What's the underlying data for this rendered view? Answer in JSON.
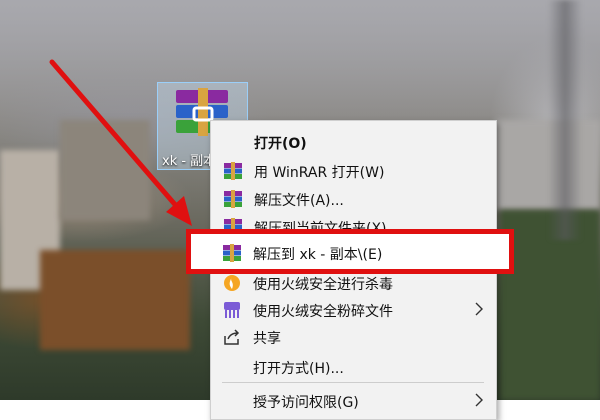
{
  "desktop_icon": {
    "label": "xk - 副本",
    "icon": "winrar-archive-icon"
  },
  "context_menu": {
    "items": [
      {
        "label": "打开(O)",
        "icon": "",
        "bold": true
      },
      {
        "label": "用 WinRAR 打开(W)",
        "icon": "winrar-icon"
      },
      {
        "label": "解压文件(A)...",
        "icon": "winrar-icon"
      },
      {
        "label": "解压到当前文件夹(X)",
        "icon": "winrar-icon"
      },
      {
        "label": "解压到 xk - 副本\\(E)",
        "icon": "winrar-icon"
      },
      {
        "label": "使用火绒安全进行杀毒",
        "icon": "huorong-icon"
      },
      {
        "label": "使用火绒安全粉碎文件",
        "icon": "shredder-icon",
        "submenu": true
      },
      {
        "label": "共享",
        "icon": "share-icon"
      },
      {
        "label": "打开方式(H)...",
        "icon": ""
      },
      {
        "label": "授予访问权限(G)",
        "icon": "",
        "submenu": true
      }
    ]
  },
  "colors": {
    "highlight": "#e01010",
    "arrow": "#e01010",
    "menu_bg": "#f2f2f2"
  }
}
